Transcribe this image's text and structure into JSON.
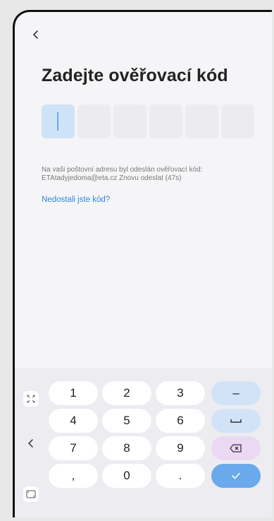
{
  "header": {
    "back_icon": "chevron-left-icon",
    "title": "Zadejte ověřovací kód"
  },
  "code": {
    "length": 6,
    "values": [
      "",
      "",
      "",
      "",
      "",
      ""
    ],
    "active_index": 0
  },
  "info": {
    "line1": "Na vaši poštovní adresu byl odeslán ověřovací kód:",
    "line2": "ETAtadyjedoma@eta.cz Znovu odeslat (47s)"
  },
  "help_link": "Nedostali jste kód?",
  "keyboard": {
    "rows": [
      [
        "1",
        "2",
        "3",
        "–"
      ],
      [
        "4",
        "5",
        "6",
        "␣"
      ],
      [
        "7",
        "8",
        "9",
        "⌫"
      ],
      [
        ",",
        "0",
        ".",
        "✓"
      ]
    ],
    "side_icons": [
      "expand-keyboard-icon",
      "chevron-left-icon",
      "resize-keyboard-icon"
    ],
    "accent_color": "#6aa9eb",
    "function_key_color": "#d3e3f7",
    "delete_key_color": "#ebd9f4"
  }
}
